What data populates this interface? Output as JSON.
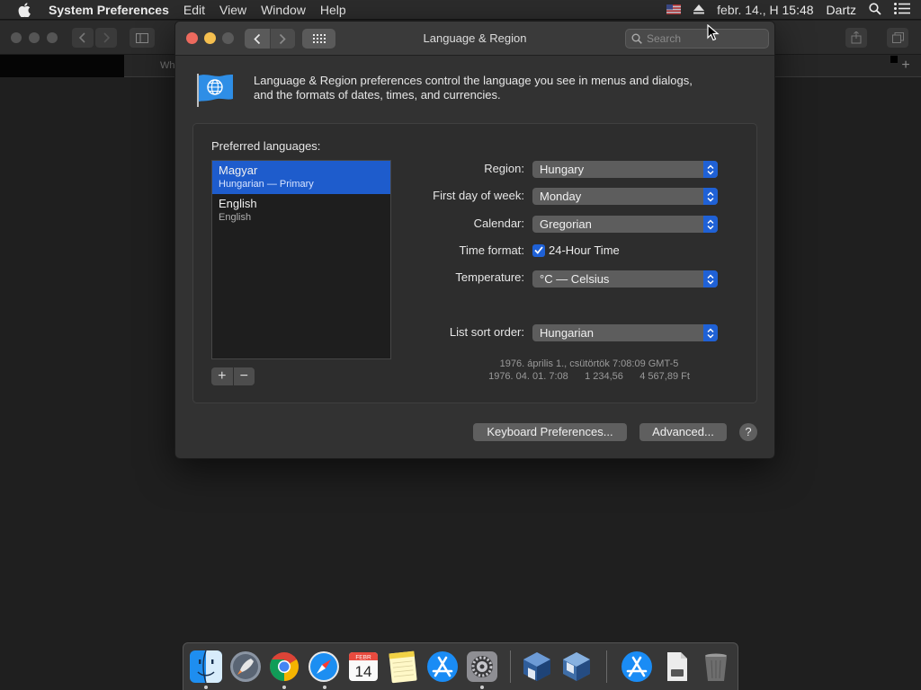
{
  "menubar": {
    "app_name": "System Preferences",
    "items": [
      "Edit",
      "View",
      "Window",
      "Help"
    ],
    "clock": "febr. 14., H  15:48",
    "user": "Dartz"
  },
  "background_window": {
    "tab_text": "Wh"
  },
  "window": {
    "title": "Language & Region",
    "search_placeholder": "Search",
    "description_line1": "Language & Region preferences control the language you see in menus and dialogs,",
    "description_line2": "and the formats of dates, times, and currencies."
  },
  "languages": {
    "label": "Preferred languages:",
    "items": [
      {
        "name": "Magyar",
        "sub": "Hungarian — Primary"
      },
      {
        "name": "English",
        "sub": "English"
      }
    ],
    "add_label": "+",
    "remove_label": "−"
  },
  "form": {
    "region_label": "Region:",
    "region_value": "Hungary",
    "first_day_label": "First day of week:",
    "first_day_value": "Monday",
    "calendar_label": "Calendar:",
    "calendar_value": "Gregorian",
    "time_format_label": "Time format:",
    "time_format_check": "24-Hour Time",
    "temperature_label": "Temperature:",
    "temperature_value": "°C — Celsius",
    "sort_label": "List sort order:",
    "sort_value": "Hungarian"
  },
  "sample": {
    "line1": "1976. április 1., csütörtök 7:08:09 GMT-5",
    "line2": "1976. 04. 01. 7:08      1 234,56      4 567,89 Ft"
  },
  "buttons": {
    "keyboard": "Keyboard Preferences...",
    "advanced": "Advanced...",
    "help": "?"
  },
  "dock": {
    "apps": [
      "finder",
      "launchpad",
      "chrome",
      "safari",
      "calendar",
      "notes",
      "app-store",
      "system-preferences",
      "virtualbox",
      "virtualbox-vm",
      "app-store-downloads",
      "documents",
      "trash"
    ],
    "calendar_month": "FEBR",
    "calendar_day": "14"
  },
  "colors": {
    "accent": "#1f61d6",
    "selection": "#1e5ccc",
    "close": "#ed6a5e",
    "minimize": "#f5bf4f"
  }
}
